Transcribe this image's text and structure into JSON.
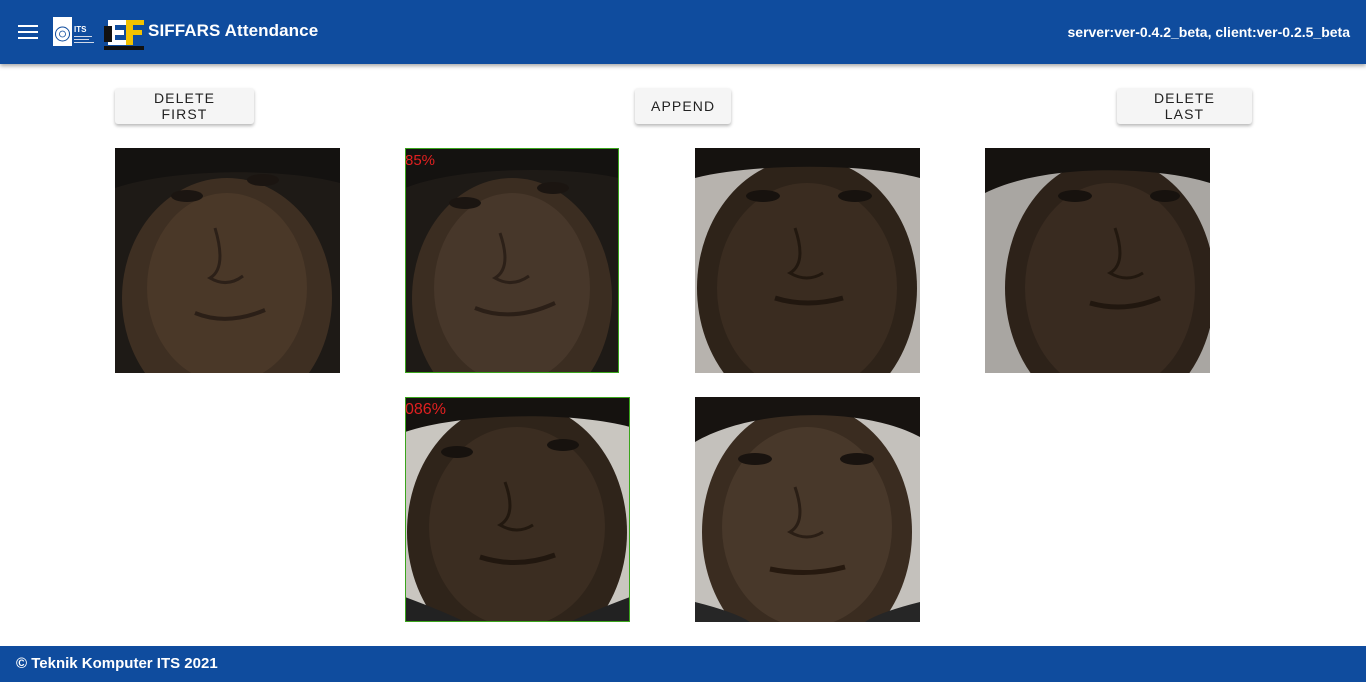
{
  "header": {
    "title": "SIFFARS Attendance",
    "version": "server:ver-0.4.2_beta, client:ver-0.2.5_beta",
    "menu_icon": "hamburger-menu-icon",
    "logos": [
      "its-logo",
      "ef-logo"
    ],
    "logo_text": "ITS",
    "color": "#0f4c9e"
  },
  "controls": {
    "delete_first": "DELETE FIRST",
    "append": "APPEND",
    "delete_last": "DELETE LAST"
  },
  "photos": [
    {
      "label": ""
    },
    {
      "label": "85%"
    },
    {
      "label": ""
    },
    {
      "label": ""
    },
    {
      "label": "086%"
    },
    {
      "label": ""
    }
  ],
  "footer": {
    "text": "© Teknik Komputer ITS 2021"
  }
}
